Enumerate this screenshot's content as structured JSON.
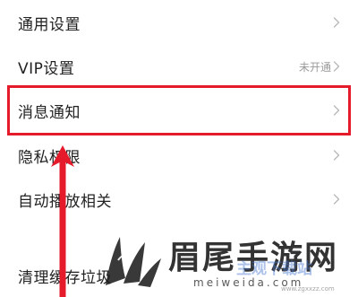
{
  "settings": {
    "items": [
      {
        "label": "通用设置",
        "value": ""
      },
      {
        "label": "VIP设置",
        "value": "未开通"
      },
      {
        "label": "消息通知",
        "value": ""
      },
      {
        "label": "隐私权限",
        "value": ""
      },
      {
        "label": "自动播放相关",
        "value": ""
      },
      {
        "label": "清理缓存垃圾",
        "value": ""
      }
    ]
  },
  "icons": {
    "row_chevron": "chevron-right-icon",
    "pointer": "up-arrow-icon"
  },
  "watermark": {
    "title": "眉尾手游网",
    "url": "meiweida.com",
    "secondary_title": "主观下载站",
    "secondary_url": "www.zgxxzz.com"
  },
  "colors": {
    "highlight": "#e51a2a",
    "label_text": "#222222",
    "value_text": "#9a9a9a",
    "chevron": "#b8b8b8"
  }
}
